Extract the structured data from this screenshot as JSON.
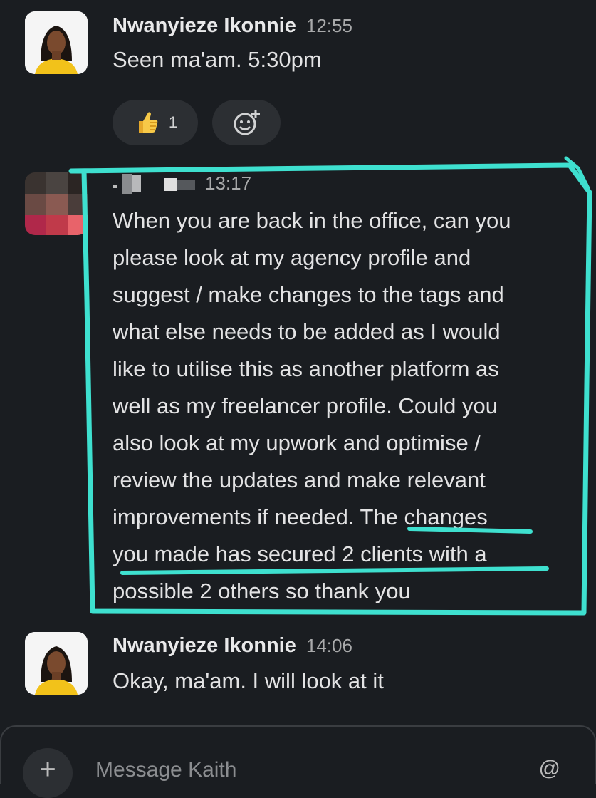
{
  "messages": [
    {
      "author": "Nwanyieze Ikonnie",
      "time": "12:55",
      "text": "Seen ma'am.  5:30pm",
      "reactions": [
        {
          "emoji": "thumbs-up",
          "count": "1"
        }
      ]
    },
    {
      "author": "",
      "time": "13:17",
      "lines": [
        "When you are back in the office, can you",
        "please look at my agency profile and",
        "suggest / make changes to the tags and",
        "what else needs to be added as I would",
        "like to utilise this as another platform as",
        "well as my freelancer profile. Could you",
        "also look at my upwork and optimise /",
        "review the updates and make relevant",
        "improvements if needed. The changes",
        "you made has secured 2 clients with a",
        "possible 2 others so thank you"
      ]
    },
    {
      "author": "Nwanyieze Ikonnie",
      "time": "14:06",
      "text": "Okay, ma'am. I will look at it"
    }
  ],
  "composer": {
    "placeholder": "Message Kaith",
    "at_symbol": "@"
  },
  "annotation_color": "#3ee0cf"
}
